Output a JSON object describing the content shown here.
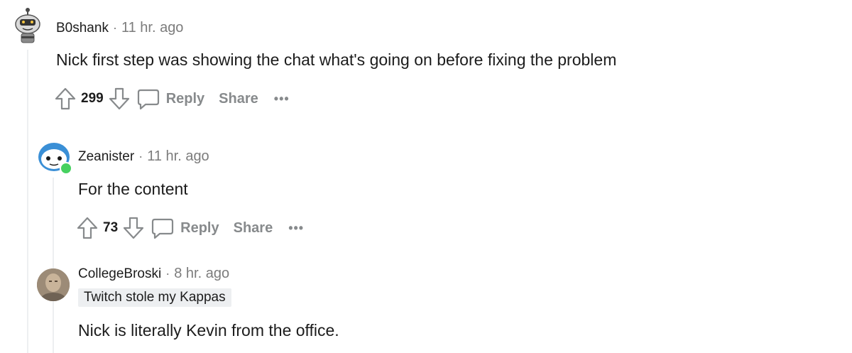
{
  "comments": [
    {
      "username": "B0shank",
      "separator": "·",
      "time": "11 hr. ago",
      "body": "Nick first step was showing the chat what's going on before fixing the problem",
      "votes": "299",
      "reply_label": "Reply",
      "share_label": "Share",
      "more_label": "•••"
    },
    {
      "username": "Zeanister",
      "separator": "·",
      "time": "11 hr. ago",
      "body": "For the content",
      "votes": "73",
      "reply_label": "Reply",
      "share_label": "Share",
      "more_label": "•••",
      "online_status_color": "#46d160"
    },
    {
      "username": "CollegeBroski",
      "separator": "·",
      "time": "8 hr. ago",
      "flair": "Twitch stole my Kappas",
      "body": "Nick is literally Kevin from the office."
    }
  ],
  "colors": {
    "text": "#1c1c1c",
    "meta": "#7c7c7c",
    "action": "#878a8c",
    "thread_line": "#edeff1",
    "flair_bg": "#edeff1"
  }
}
